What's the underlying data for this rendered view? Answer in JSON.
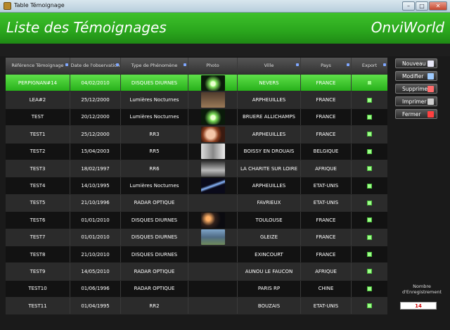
{
  "window": {
    "title": "Table Témoignage"
  },
  "header": {
    "title": "Liste des Témoignages",
    "brand": "OnviWorld"
  },
  "table": {
    "columns": [
      "Référence Témoignage",
      "Date de l'observation",
      "Type de Phénomène",
      "Photo",
      "Ville",
      "Pays",
      "Export"
    ],
    "rows": [
      {
        "ref": "PERPIGNAN#14",
        "date": "04/02/2010",
        "type": "DISQUES DIURNES",
        "photo": "ufo-light-photo",
        "city": "NEVERS",
        "country": "FRANCE",
        "selected": true
      },
      {
        "ref": "LEA#2",
        "date": "25/12/2000",
        "type": "Lumières Nocturnes",
        "photo": "sky-photo",
        "city": "ARPHEUILLES",
        "country": "FRANCE"
      },
      {
        "ref": "TEST",
        "date": "20/12/2000",
        "type": "Lumières Nocturnes",
        "photo": "ufo-light-photo",
        "city": "BRUERE ALLICHAMPS",
        "country": "FRANCE"
      },
      {
        "ref": "TEST1",
        "date": "25/12/2000",
        "type": "RR3",
        "photo": "alien-photo",
        "city": "ARPHEUILLES",
        "country": "FRANCE"
      },
      {
        "ref": "TEST2",
        "date": "15/04/2003",
        "type": "RR5",
        "photo": "figure-photo",
        "city": "BOISSY EN DROUAIS",
        "country": "BELGIQUE"
      },
      {
        "ref": "TEST3",
        "date": "18/02/1997",
        "type": "RR6",
        "photo": "bw-photo",
        "city": "LA CHARITE SUR LOIRE",
        "country": "AFRIQUE"
      },
      {
        "ref": "TEST4",
        "date": "14/10/1995",
        "type": "Lumières Nocturnes",
        "photo": "beam-photo",
        "city": "ARPHEUILLES",
        "country": "ETAT-UNIS"
      },
      {
        "ref": "TEST5",
        "date": "21/10/1996",
        "type": "RADAR OPTIQUE",
        "photo": "",
        "city": "FAVRIEUX",
        "country": "ETAT-UNIS"
      },
      {
        "ref": "TEST6",
        "date": "01/01/2010",
        "type": "DISQUES DIURNES",
        "photo": "night-photo",
        "city": "TOULOUSE",
        "country": "FRANCE"
      },
      {
        "ref": "TEST7",
        "date": "01/01/2010",
        "type": "DISQUES DIURNES",
        "photo": "landscape-photo",
        "city": "GLEIZE",
        "country": "FRANCE"
      },
      {
        "ref": "TEST8",
        "date": "21/10/2010",
        "type": "DISQUES DIURNES",
        "photo": "",
        "city": "EXINCOURT",
        "country": "FRANCE"
      },
      {
        "ref": "TEST9",
        "date": "14/05/2010",
        "type": "RADAR OPTIQUE",
        "photo": "",
        "city": "AUNOU LE FAUCON",
        "country": "AFRIQUE"
      },
      {
        "ref": "TEST10",
        "date": "01/06/1996",
        "type": "RADAR OPTIQUE",
        "photo": "",
        "city": "PARIS RP",
        "country": "CHINE"
      },
      {
        "ref": "TEST11",
        "date": "01/04/1995",
        "type": "RR2",
        "photo": "",
        "city": "BOUZAIS",
        "country": "ETAT-UNIS"
      }
    ]
  },
  "actions": [
    {
      "label": "Nouveau",
      "icon": "new-icon",
      "color": "#e8e8f8"
    },
    {
      "label": "Modifier",
      "icon": "edit-icon",
      "color": "#9ecbff"
    },
    {
      "label": "Supprimer",
      "icon": "delete-icon",
      "color": "#ff6b6b"
    },
    {
      "label": "Imprimer",
      "icon": "print-icon",
      "color": "#cfcfcf"
    },
    {
      "label": "Fermer",
      "icon": "close-icon",
      "color": "#ff4040"
    }
  ],
  "count": {
    "label": "Nombre d'Enregistrement",
    "value": "14"
  }
}
